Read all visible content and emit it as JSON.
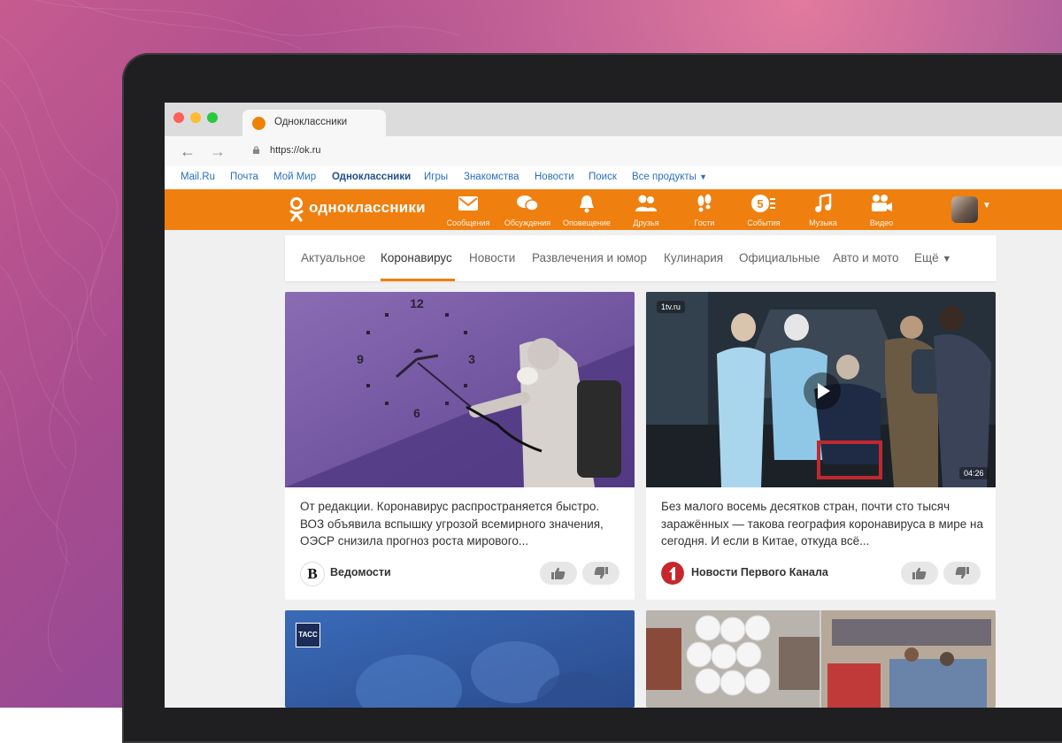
{
  "browser": {
    "tab_title": "Одноклассники",
    "url": "https://ok.ru"
  },
  "mailbar": {
    "items": [
      "Mail.Ru",
      "Почта",
      "Мой Мир",
      "Одноклассники",
      "Игры",
      "Знакомства",
      "Новости",
      "Поиск",
      "Все продукты"
    ],
    "active": "Одноклассники"
  },
  "okbar": {
    "logo_text": "одноклассники",
    "items": [
      {
        "label": "Сообщения",
        "icon": "envelope-icon"
      },
      {
        "label": "Обсуждения",
        "icon": "chat-bubbles-icon"
      },
      {
        "label": "Оповещение",
        "icon": "bell-icon"
      },
      {
        "label": "Друзья",
        "icon": "friends-icon"
      },
      {
        "label": "Гости",
        "icon": "footprints-icon"
      },
      {
        "label": "События",
        "icon": "events-icon"
      },
      {
        "label": "Музыка",
        "icon": "music-note-icon"
      },
      {
        "label": "Видео",
        "icon": "video-camera-icon"
      }
    ]
  },
  "categories": {
    "items": [
      "Актуальное",
      "Коронавирус",
      "Новости",
      "Развлечения и юмор",
      "Кулинария",
      "Официальные",
      "Авто и мото",
      "Ещё"
    ],
    "active": "Коронавирус"
  },
  "cards": [
    {
      "text": "От редакции. Коронавирус распространяется быстро. ВОЗ объявила вспышку угрозой всемирного значения, ОЭСР снизила прогноз роста мирового...",
      "source": "Ведомости",
      "source_logo": "В"
    },
    {
      "badge": "1tv.ru",
      "duration": "04:26",
      "text": "Без малого восемь десятков стран, почти сто тысяч заражённых — такова география коронавируса в мире на сегодня. И если в Китае, откуда всё...",
      "source": "Новости Первого Канала"
    },
    {
      "badge": "ТАСС"
    },
    {}
  ],
  "colors": {
    "ok_orange": "#ef7f0f",
    "link_blue": "#2a6fbb"
  }
}
